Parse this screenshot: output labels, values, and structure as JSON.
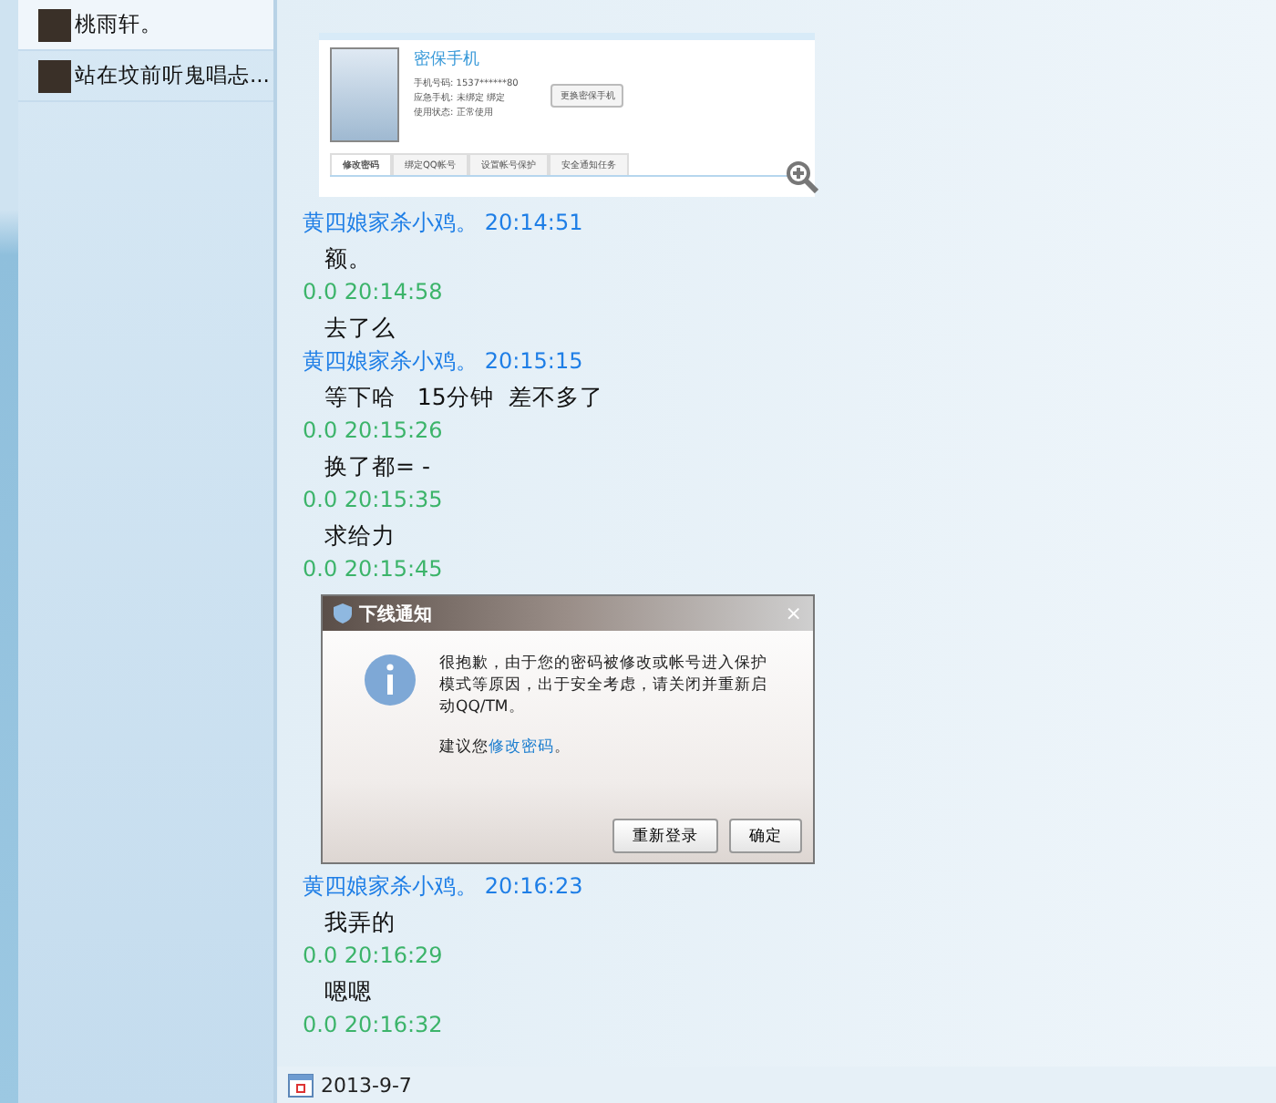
{
  "contacts": [
    {
      "name": "桃雨轩。",
      "selected": true
    },
    {
      "name": "站在坟前听鬼唱忐...",
      "selected": false
    }
  ],
  "messages": [
    {
      "kind": "screenshot",
      "title": "密保手机",
      "fields": [
        {
          "label": "手机号码:",
          "value": "1537******80"
        },
        {
          "label": "应急手机:",
          "value": "未绑定  绑定"
        },
        {
          "label": "使用状态:",
          "value": "正常使用"
        }
      ],
      "button": "更换密保手机",
      "tabs": [
        {
          "label": "修改密码",
          "selected": true
        },
        {
          "label": "绑定QQ帐号",
          "selected": false
        },
        {
          "label": "设置帐号保护",
          "selected": false
        },
        {
          "label": "安全通知任务",
          "selected": false
        }
      ]
    },
    {
      "kind": "header",
      "sender": "黄四娘家杀小鸡。",
      "time": "20:14:51",
      "color": "#1e7ee6"
    },
    {
      "kind": "text",
      "text": "额。"
    },
    {
      "kind": "header",
      "sender": "0.0",
      "time": "20:14:58",
      "color": "#3cb46a"
    },
    {
      "kind": "text",
      "text": "去了么"
    },
    {
      "kind": "header",
      "sender": "黄四娘家杀小鸡。",
      "time": "20:15:15",
      "color": "#1e7ee6"
    },
    {
      "kind": "text",
      "text": "等下哈   15分钟  差不多了"
    },
    {
      "kind": "header",
      "sender": "0.0",
      "time": "20:15:26",
      "color": "#3cb46a"
    },
    {
      "kind": "text",
      "text": "换了都= -"
    },
    {
      "kind": "header",
      "sender": "0.0",
      "time": "20:15:35",
      "color": "#3cb46a"
    },
    {
      "kind": "text",
      "text": "求给力"
    },
    {
      "kind": "header",
      "sender": "0.0",
      "time": "20:15:45",
      "color": "#3cb46a"
    },
    {
      "kind": "dialog",
      "title": "下线通知",
      "close": "×",
      "body": "很抱歉，由于您的密码被修改或帐号进入保护模式等原因，出于安全考虑，请关闭并重新启动QQ/TM。",
      "hint": "建议您",
      "link": "修改密码",
      "hint_end": "。",
      "buttons": [
        "重新登录",
        "确定"
      ]
    },
    {
      "kind": "header",
      "sender": "黄四娘家杀小鸡。",
      "time": "20:16:23",
      "color": "#1e7ee6"
    },
    {
      "kind": "text",
      "text": "我弄的"
    },
    {
      "kind": "header",
      "sender": "0.0",
      "time": "20:16:29",
      "color": "#3cb46a"
    },
    {
      "kind": "text",
      "text": "嗯嗯"
    },
    {
      "kind": "header",
      "sender": "0.0",
      "time": "20:16:32",
      "color": "#3cb46a"
    }
  ],
  "date": "2013-9-7"
}
